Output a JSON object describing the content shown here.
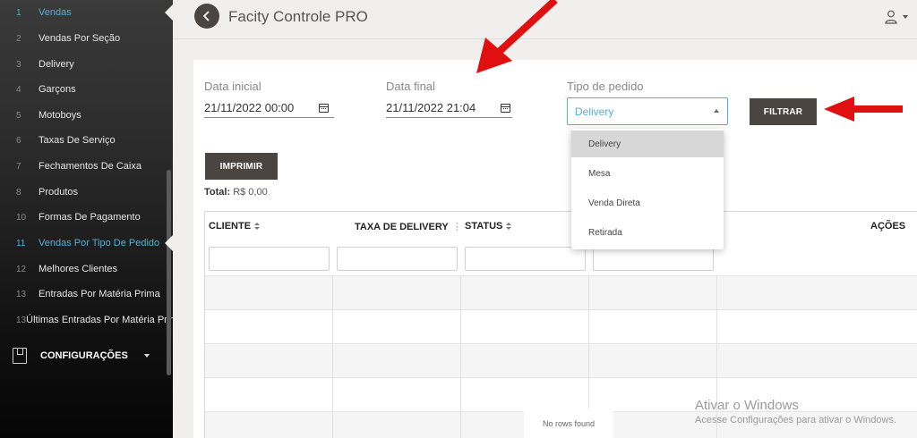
{
  "sidebar": {
    "items": [
      {
        "num": "1",
        "label": "Vendas"
      },
      {
        "num": "2",
        "label": "Vendas Por Seção"
      },
      {
        "num": "3",
        "label": "Delivery"
      },
      {
        "num": "4",
        "label": "Garçons"
      },
      {
        "num": "5",
        "label": "Motoboys"
      },
      {
        "num": "6",
        "label": "Taxas De Serviço"
      },
      {
        "num": "7",
        "label": "Fechamentos De Caixa"
      },
      {
        "num": "8",
        "label": "Produtos"
      },
      {
        "num": "10",
        "label": "Formas De Pagamento"
      },
      {
        "num": "11",
        "label": "Vendas Por Tipo De Pedido"
      },
      {
        "num": "12",
        "label": "Melhores Clientes"
      },
      {
        "num": "13",
        "label": "Entradas Por Matéria Prima"
      },
      {
        "num": "13",
        "label": "Últimas Entradas Por Matéria Prima"
      }
    ],
    "config_label": "CONFIGURAÇÕES",
    "accent_color": "#4fb3d9"
  },
  "header": {
    "title": "Facity Controle PRO",
    "back_icon": "chevron-left-icon",
    "user_icon": "user-icon"
  },
  "filters": {
    "start_label": "Data inicial",
    "start_value": "21/11/2022 00:00",
    "end_label": "Data final",
    "end_value": "21/11/2022 21:04",
    "type_label": "Tipo de pedido",
    "type_value": "Delivery",
    "type_options": [
      "Delivery",
      "Mesa",
      "Venda Direta",
      "Retirada"
    ],
    "filter_button": "FILTRAR",
    "print_button": "IMPRIMIR"
  },
  "total": {
    "label": "Total:",
    "value": "R$ 0,00"
  },
  "table": {
    "columns": [
      "CLIENTE",
      "TAXA DE DELIVERY",
      "STATUS",
      "AÇÕES"
    ],
    "empty_text": "No rows found"
  },
  "watermark": {
    "title": "Ativar o Windows",
    "subtitle": "Acesse Configurações para ativar o Windows."
  }
}
